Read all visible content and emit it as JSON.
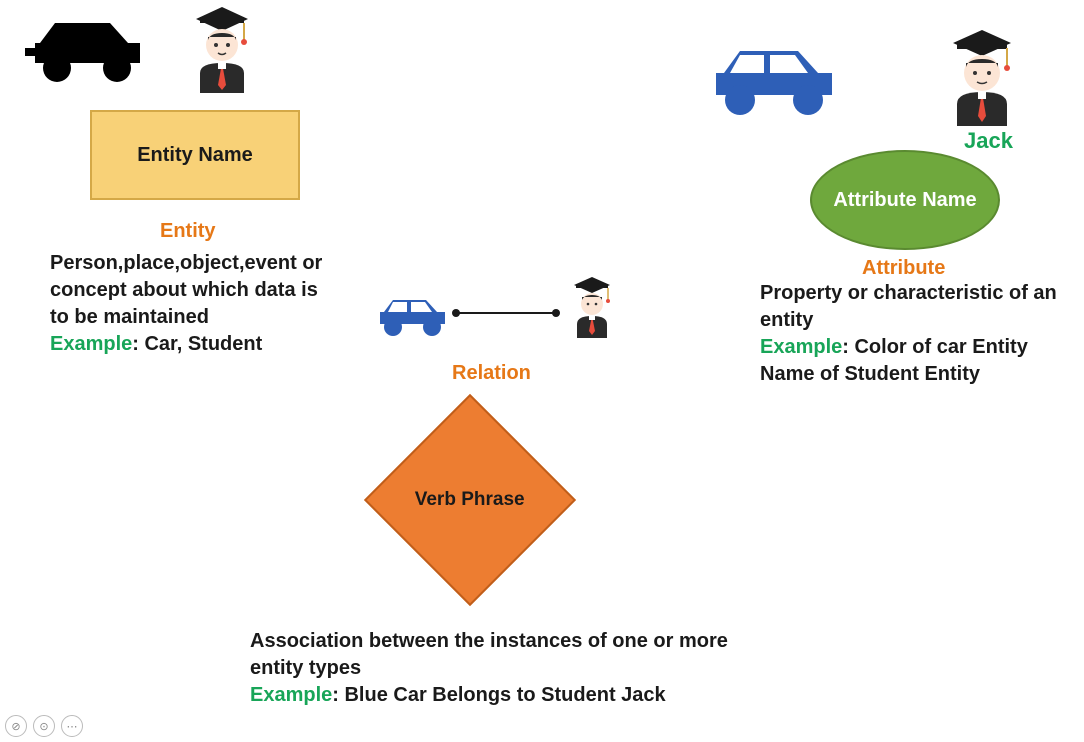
{
  "entity": {
    "box_label": "Entity Name",
    "title": "Entity",
    "description": "Person,place,object,event or concept about which data is to be maintained",
    "example_label": "Example",
    "example_text": ": Car, Student"
  },
  "attribute": {
    "ellipse_label": "Attribute Name",
    "title": "Attribute",
    "jack_label": "Jack",
    "description": "Property or characteristic of an entity",
    "example_label": "Example",
    "example_text": ": Color of car Entity Name of Student Entity"
  },
  "relation": {
    "diamond_label": "Verb Phrase",
    "title": "Relation",
    "description": "Association between the instances of one or more entity types",
    "example_label": "Example",
    "example_text": ": Blue Car Belongs to Student Jack"
  },
  "toolbar": {
    "btn1": "⊘",
    "btn2": "⊙",
    "btn3": "⋯"
  }
}
